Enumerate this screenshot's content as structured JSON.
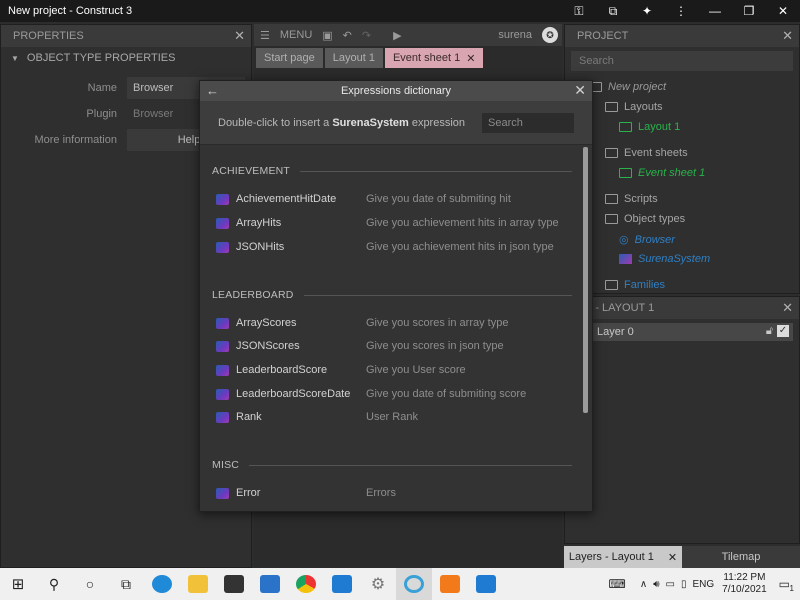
{
  "window": {
    "title": "New project - Construct 3"
  },
  "properties": {
    "panel_title": "PROPERTIES",
    "section_title": "OBJECT TYPE PROPERTIES",
    "rows": [
      {
        "label": "Name",
        "value": "Browser"
      },
      {
        "label": "Plugin",
        "value": "Browser"
      },
      {
        "label": "More information",
        "value": "Help"
      }
    ]
  },
  "toolbar": {
    "menu_label": "MENU",
    "user": "surena"
  },
  "tabs": [
    {
      "label": "Start page"
    },
    {
      "label": "Layout 1"
    },
    {
      "label": "Event sheet 1"
    }
  ],
  "project": {
    "panel_title": "PROJECT",
    "search_placeholder": "Search",
    "tree": {
      "root": "New project",
      "layouts": "Layouts",
      "layout1": "Layout 1",
      "eventsheets": "Event sheets",
      "eventsheet1": "Event sheet 1",
      "scripts": "Scripts",
      "objecttypes": "Object types",
      "browser": "Browser",
      "surenasystem": "SurenaSystem",
      "families": "Families"
    }
  },
  "layers": {
    "panel_title": "RS - LAYOUT 1",
    "row_label": "Layer 0"
  },
  "bottom_tabs": {
    "layers": "Layers - Layout 1",
    "tilemap": "Tilemap"
  },
  "dialog": {
    "title": "Expressions dictionary",
    "sub_prefix": "Double-click to insert a ",
    "sub_bold": "SurenaSystem",
    "sub_suffix": " expression",
    "search_placeholder": "Search",
    "sections": [
      {
        "name": "ACHIEVEMENT",
        "items": [
          {
            "name": "AchievementHitDate",
            "desc": "Give you date of submiting hit"
          },
          {
            "name": "ArrayHits",
            "desc": "Give you achievement hits in array type"
          },
          {
            "name": "JSONHits",
            "desc": "Give you achievement hits in json type"
          }
        ]
      },
      {
        "name": "LEADERBOARD",
        "items": [
          {
            "name": "ArrayScores",
            "desc": "Give you scores in array type"
          },
          {
            "name": "JSONScores",
            "desc": "Give you scores in json type"
          },
          {
            "name": "LeaderboardScore",
            "desc": "Give you User score"
          },
          {
            "name": "LeaderboardScoreDate",
            "desc": "Give you date of submiting score"
          },
          {
            "name": "Rank",
            "desc": "User Rank"
          }
        ]
      },
      {
        "name": "MISC",
        "items": [
          {
            "name": "Error",
            "desc": "Errors"
          }
        ]
      }
    ]
  },
  "taskbar": {
    "lang": "ENG",
    "time": "11:22 PM",
    "date": "7/10/2021",
    "notifications": "1"
  }
}
